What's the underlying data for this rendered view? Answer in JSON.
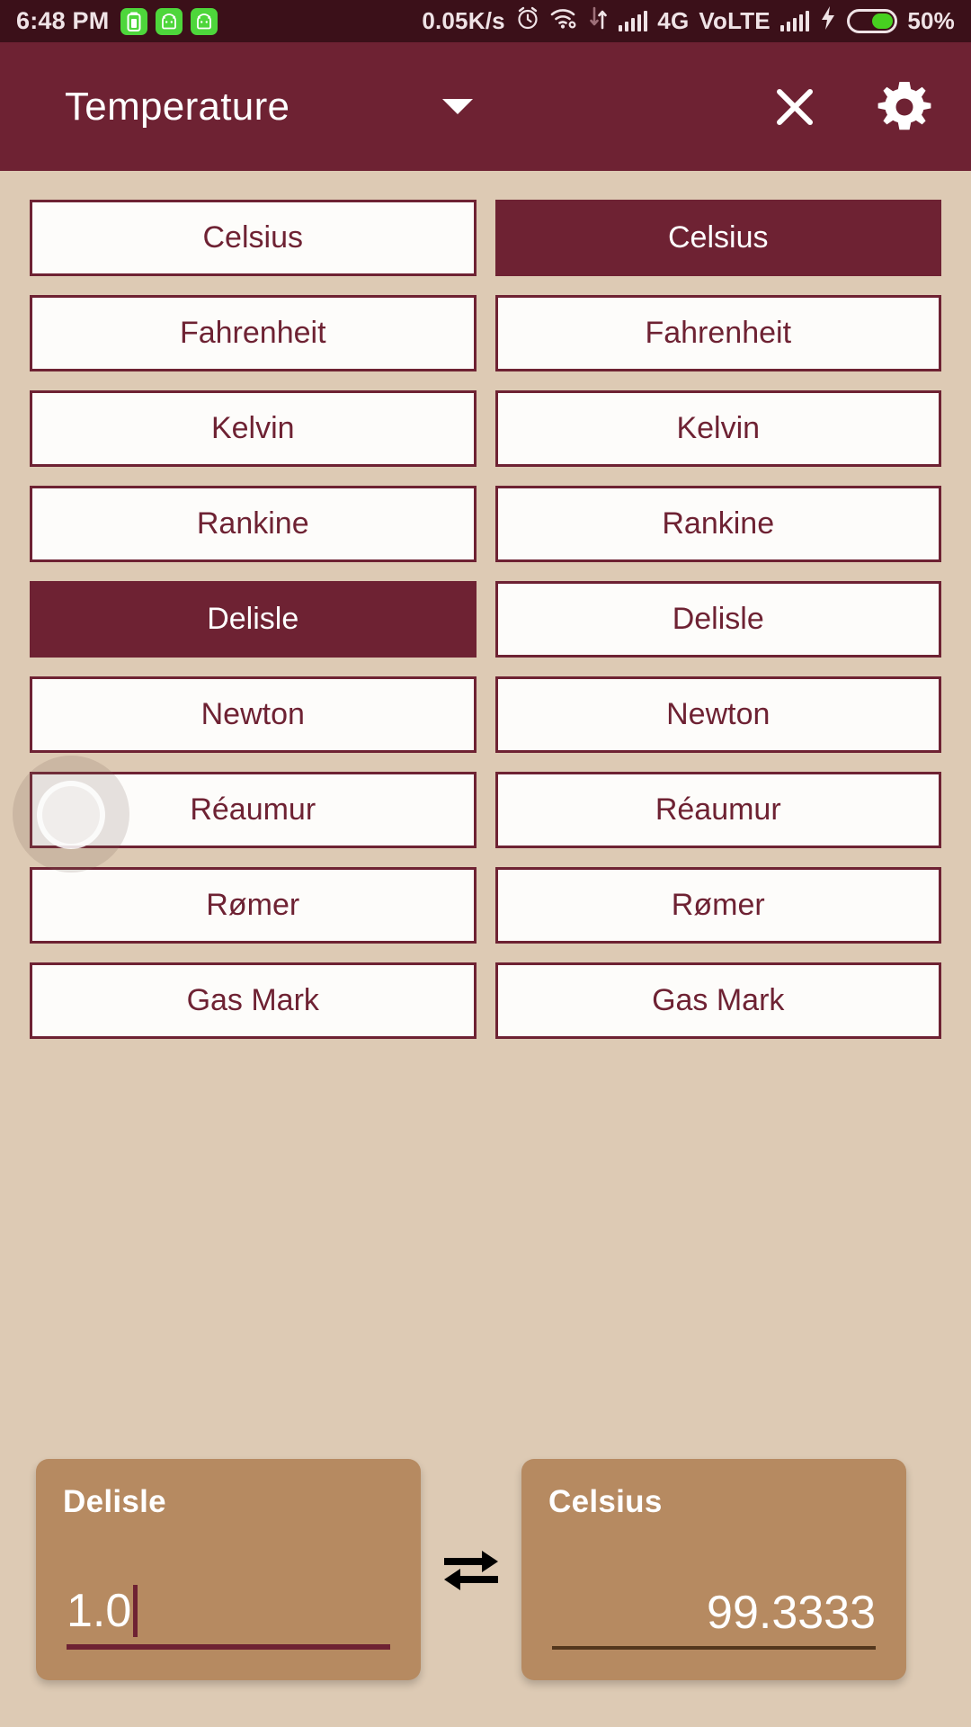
{
  "status_bar": {
    "time": "6:48 PM",
    "network_speed": "0.05K/s",
    "network_type": "4G",
    "volte": "VoLTE",
    "battery_percent": "50%",
    "icons": [
      "battery-app-icon",
      "android-app-icon",
      "android-app-icon",
      "alarm-clock-icon",
      "wifi-icon",
      "data-transfer-icon",
      "signal-bars-icon",
      "signal-bars-icon",
      "charging-bolt-icon",
      "battery-icon"
    ],
    "background_color": "#3b1019",
    "text_color": "#efe3e6"
  },
  "app_bar": {
    "title": "Temperature",
    "dropdown_icon": "chevron-down-icon",
    "close_icon": "close-icon",
    "settings_icon": "gear-icon",
    "background_color": "#6e2233",
    "text_color": "#ffffff"
  },
  "theme": {
    "page_background": "#ddcab4",
    "primary": "#6e2233",
    "card_background": "#b68a61",
    "button_background": "#fdfcfa"
  },
  "units": {
    "left_column": [
      {
        "label": "Celsius",
        "selected": false
      },
      {
        "label": "Fahrenheit",
        "selected": false
      },
      {
        "label": "Kelvin",
        "selected": false
      },
      {
        "label": "Rankine",
        "selected": false
      },
      {
        "label": "Delisle",
        "selected": true
      },
      {
        "label": "Newton",
        "selected": false
      },
      {
        "label": "Réaumur",
        "selected": false
      },
      {
        "label": "Rømer",
        "selected": false
      },
      {
        "label": "Gas Mark",
        "selected": false
      }
    ],
    "right_column": [
      {
        "label": "Celsius",
        "selected": true
      },
      {
        "label": "Fahrenheit",
        "selected": false
      },
      {
        "label": "Kelvin",
        "selected": false
      },
      {
        "label": "Rankine",
        "selected": false
      },
      {
        "label": "Delisle",
        "selected": false
      },
      {
        "label": "Newton",
        "selected": false
      },
      {
        "label": "Réaumur",
        "selected": false
      },
      {
        "label": "Rømer",
        "selected": false
      },
      {
        "label": "Gas Mark",
        "selected": false
      }
    ]
  },
  "conversion": {
    "source": {
      "unit_label": "Delisle",
      "value": "1.0",
      "has_cursor": true
    },
    "swap_icon": "swap-horizontal-icon",
    "target": {
      "unit_label": "Celsius",
      "value": "99.3333"
    }
  }
}
